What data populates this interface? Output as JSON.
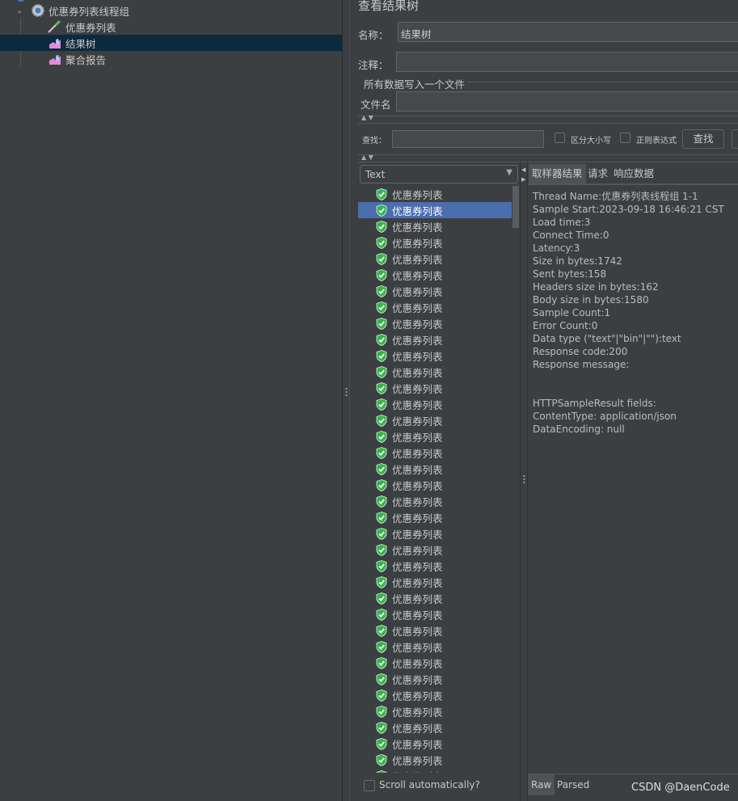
{
  "tree": {
    "items": [
      {
        "label": "优惠券列表线程组",
        "icon": "gear-icon"
      },
      {
        "label": "优惠券列表",
        "icon": "pipette-icon"
      },
      {
        "label": "结果树",
        "icon": "graph-icon",
        "selected": true
      },
      {
        "label": "聚合报告",
        "icon": "graph-icon"
      }
    ]
  },
  "panel": {
    "title": "查看结果树",
    "name_label": "名称：",
    "name_value": "结果树",
    "comment_label": "注释：",
    "comment_value": "",
    "file_group": "所有数据写入一个文件",
    "file_label": "文件名",
    "file_value": ""
  },
  "search": {
    "label": "查找：",
    "value": "",
    "case_label": "区分大小写",
    "regex_label": "正则表达式",
    "button": "查找"
  },
  "results": {
    "renderer": "Text",
    "selected_index": 1,
    "items": [
      "优惠券列表",
      "优惠券列表",
      "优惠券列表",
      "优惠券列表",
      "优惠券列表",
      "优惠券列表",
      "优惠券列表",
      "优惠券列表",
      "优惠券列表",
      "优惠券列表",
      "优惠券列表",
      "优惠券列表",
      "优惠券列表",
      "优惠券列表",
      "优惠券列表",
      "优惠券列表",
      "优惠券列表",
      "优惠券列表",
      "优惠券列表",
      "优惠券列表",
      "优惠券列表",
      "优惠券列表",
      "优惠券列表",
      "优惠券列表",
      "优惠券列表",
      "优惠券列表",
      "优惠券列表",
      "优惠券列表",
      "优惠券列表",
      "优惠券列表",
      "优惠券列表",
      "优惠券列表",
      "优惠券列表",
      "优惠券列表",
      "优惠券列表",
      "优惠券列表",
      "优惠券列表",
      "优惠券列表"
    ],
    "scroll_label": "Scroll automatically?",
    "success_color": "#2fb84a"
  },
  "detail": {
    "tabs": [
      "取样器结果",
      "请求",
      "响应数据"
    ],
    "lines": [
      "Thread Name:优惠券列表线程组 1-1",
      "Sample Start:2023-09-18 16:46:21 CST",
      "Load time:3",
      "Connect Time:0",
      "Latency:3",
      "Size in bytes:1742",
      "Sent bytes:158",
      "Headers size in bytes:162",
      "Body size in bytes:1580",
      "Sample Count:1",
      "Error Count:0",
      "Data type (\"text\"|\"bin\"|\"\"):text",
      "Response code:200",
      "Response message:",
      "",
      "",
      "HTTPSampleResult fields:",
      "ContentType: application/json",
      "DataEncoding: null"
    ],
    "bottom_tabs": [
      "Raw",
      "Parsed"
    ]
  },
  "watermark": "CSDN @DaenCode"
}
